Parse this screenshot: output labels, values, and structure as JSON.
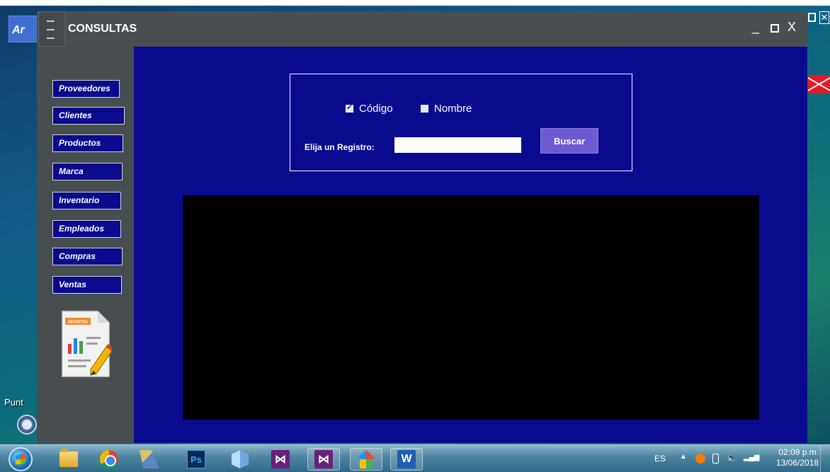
{
  "desktop": {
    "bg_window_title_fragment": "Ar",
    "shortcut_label_fragment": "Punt"
  },
  "window": {
    "title": "CONSULTAS",
    "controls": {
      "minimize": "_",
      "close": "X"
    }
  },
  "sidebar": {
    "items": [
      {
        "label": "Proveedores"
      },
      {
        "label": "Clientes"
      },
      {
        "label": "Productos"
      },
      {
        "label": "Marca"
      },
      {
        "label": "Inventario"
      },
      {
        "label": "Empleados"
      },
      {
        "label": "Compras"
      },
      {
        "label": "Ventas"
      }
    ],
    "report_icon_text": "REPORTES"
  },
  "search": {
    "option_codigo": {
      "label": "Código",
      "checked": true
    },
    "option_nombre": {
      "label": "Nombre",
      "checked": false
    },
    "register_label": "Elija un Registro:",
    "register_value": "",
    "button_label": "Buscar"
  },
  "taskbar": {
    "language": "ES",
    "time": "02:09 p.m.",
    "date": "13/06/2018",
    "apps": [
      "file-explorer",
      "chrome",
      "tools",
      "photoshop",
      "virtual-box",
      "visual-studio",
      "visual-studio",
      "app-house",
      "word"
    ],
    "ps_text": "Ps",
    "word_text": "W"
  },
  "colors": {
    "app_background": "#0a0a8f",
    "titlebar": "#4a4f52",
    "sidebar": "#484e50",
    "search_button": "#6c5bd1",
    "results_grid": "#000000"
  }
}
